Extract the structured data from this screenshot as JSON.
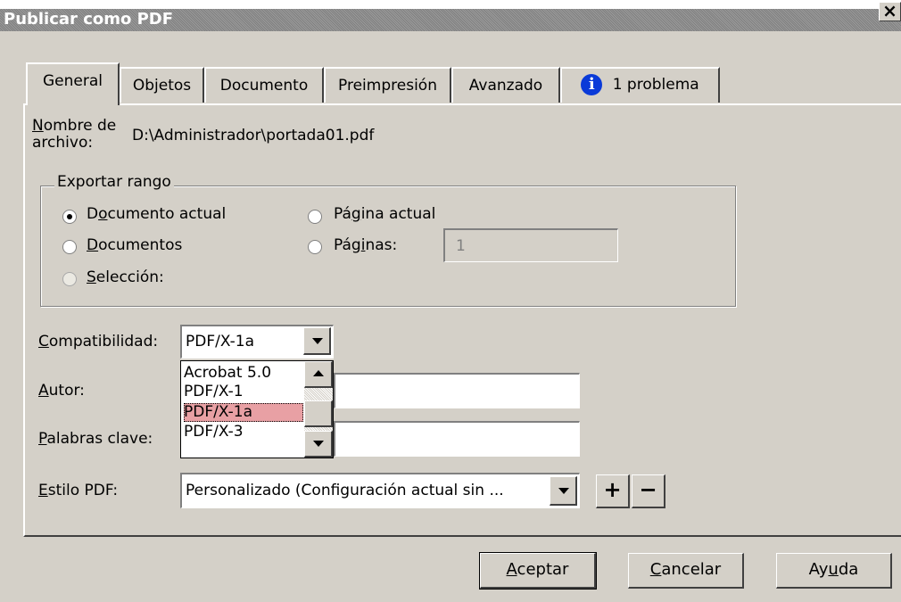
{
  "window": {
    "title": "Publicar como PDF",
    "close_label": "×"
  },
  "tabs": [
    {
      "label": "General"
    },
    {
      "label": "Objetos"
    },
    {
      "label": "Documento"
    },
    {
      "label": "Preimpresión"
    },
    {
      "label": "Avanzado"
    },
    {
      "label": "1 problema",
      "icon": "info-icon",
      "icon_glyph": "i"
    }
  ],
  "filename": {
    "label_line1": "Nombre de",
    "label_line2": "archivo:",
    "value": "D:\\Administrador\\portada01.pdf"
  },
  "export_range": {
    "legend": "Exportar rango",
    "options": [
      {
        "label": "Documento actual",
        "selected": true,
        "enabled": true
      },
      {
        "label": "Página actual",
        "selected": false,
        "enabled": true
      },
      {
        "label": "Documentos",
        "selected": false,
        "enabled": true
      },
      {
        "label": "Páginas:",
        "selected": false,
        "enabled": true
      },
      {
        "label": "Selección:",
        "selected": false,
        "enabled": false
      }
    ],
    "pages_value": "1"
  },
  "compat": {
    "label": "Compatibilidad:",
    "value": "PDF/X-1a",
    "options": [
      "Acrobat 5.0",
      "PDF/X-1",
      "PDF/X-1a",
      "PDF/X-3"
    ],
    "selected_index": 2
  },
  "author": {
    "label": "Autor:",
    "value": ""
  },
  "keywords": {
    "label": "Palabras clave:",
    "value": ""
  },
  "pdf_style": {
    "label": "Estilo PDF:",
    "value": "Personalizado (Configuración actual sin ...",
    "add_label": "+",
    "remove_label": "−"
  },
  "buttons": {
    "ok": "Aceptar",
    "cancel": "Cancelar",
    "help": "Ayuda"
  },
  "colors": {
    "selected_item": "#e8a0a4",
    "info_icon": "#0a3ad8"
  }
}
